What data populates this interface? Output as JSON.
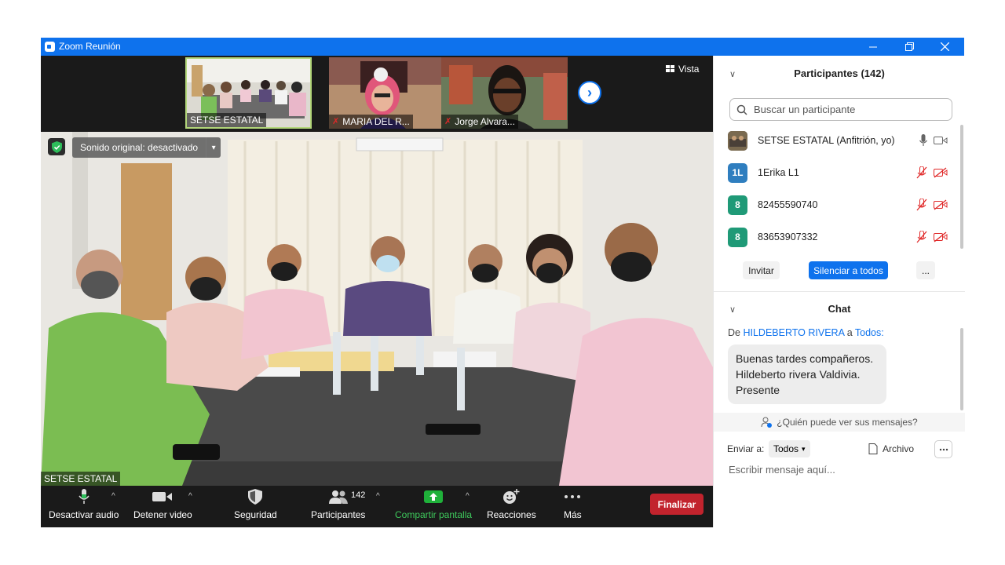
{
  "window": {
    "title": "Zoom Reunión"
  },
  "thumbnails": [
    {
      "name": "SETSE ESTATAL",
      "muted": false
    },
    {
      "name": "MARIA DEL R...",
      "muted": true
    },
    {
      "name": "Jorge Alvara...",
      "muted": true
    }
  ],
  "view_label": "Vista",
  "main": {
    "original_sound": "Sonido original: desactivado",
    "speaker_name": "SETSE ESTATAL"
  },
  "toolbar": {
    "mute": "Desactivar audio",
    "video": "Detener video",
    "security": "Seguridad",
    "participants": "Participantes",
    "participant_count": "142",
    "share": "Compartir pantalla",
    "reactions": "Reacciones",
    "more": "Más",
    "end": "Finalizar"
  },
  "participants_panel": {
    "title": "Participantes (142)",
    "search_placeholder": "Buscar un participante",
    "list": [
      {
        "avatar": "",
        "name": "SETSE ESTATAL (Anfitrión, yo)",
        "color": "#6a5a40"
      },
      {
        "avatar": "1L",
        "name": "1Erika L1",
        "color": "#2f7ebf"
      },
      {
        "avatar": "8",
        "name": "82455590740",
        "color": "#1f9a77"
      },
      {
        "avatar": "8",
        "name": "83653907332",
        "color": "#1f9a77"
      }
    ],
    "invite": "Invitar",
    "mute_all": "Silenciar a todos",
    "more": "..."
  },
  "chat": {
    "title": "Chat",
    "from_prefix": "De",
    "from": "HILDEBERTO RIVERA",
    "to_prefix": "a",
    "to": "Todos:",
    "messages": [
      {
        "line1": "Buenas tardes compañeros.",
        "line2": "Hildeberto rivera Valdivia.",
        "line3": "Presente"
      }
    ],
    "who_can_see": "¿Quién puede ver sus mensajes?",
    "send_to_label": "Enviar a:",
    "send_to_value": "Todos",
    "file_label": "Archivo",
    "input_placeholder": "Escribir mensaje aquí..."
  },
  "colors": {
    "accent": "#0e72ed",
    "end": "#c2232d",
    "share": "#1fb13a"
  }
}
